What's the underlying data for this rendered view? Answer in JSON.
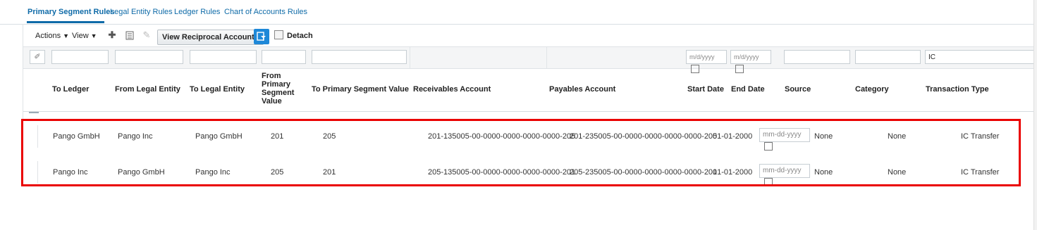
{
  "tabs": [
    {
      "label": "Primary Segment Rules",
      "active": true
    },
    {
      "label": "Legal Entity Rules",
      "active": false
    },
    {
      "label": "Ledger Rules",
      "active": false
    },
    {
      "label": "Chart of Accounts Rules",
      "active": false
    }
  ],
  "toolbar": {
    "actions_label": "Actions",
    "view_label": "View",
    "view_reciprocal_label": "View Reciprocal Accounts",
    "detach_label": "Detach",
    "icons": [
      "add-icon",
      "edit-list-icon",
      "pencil-icon",
      "filter-icon",
      "detach-icon"
    ]
  },
  "filters": {
    "start_date_placeholder": "m/d/yyyy",
    "end_date_placeholder": "m/d/yyyy",
    "transaction_type_value": "IC"
  },
  "columns": [
    "To Ledger",
    "From Legal Entity",
    "To Legal Entity",
    "From Primary Segment Value",
    "To Primary Segment Value",
    "Receivables Account",
    "Payables Account",
    "Start Date",
    "End Date",
    "Source",
    "Category",
    "Transaction Type"
  ],
  "rows": [
    {
      "to_ledger": "Pango GmbH",
      "from_legal_entity": "Pango Inc",
      "to_legal_entity": "Pango GmbH",
      "from_primary": "201",
      "to_primary": "205",
      "receivables": "201-135005-00-0000-0000-0000-0000-205",
      "payables": "201-235005-00-0000-0000-0000-0000-205",
      "start_date": "01-01-2000",
      "end_date_placeholder": "mm-dd-yyyy",
      "source": "None",
      "category": "None",
      "transaction_type": "IC Transfer"
    },
    {
      "to_ledger": "Pango Inc",
      "from_legal_entity": "Pango GmbH",
      "to_legal_entity": "Pango Inc",
      "from_primary": "205",
      "to_primary": "201",
      "receivables": "205-135005-00-0000-0000-0000-0000-201",
      "payables": "205-235005-00-0000-0000-0000-0000-201",
      "start_date": "01-01-2000",
      "end_date_placeholder": "mm-dd-yyyy",
      "source": "None",
      "category": "None",
      "transaction_type": "IC Transfer"
    }
  ],
  "colors": {
    "accent": "#0f6ba8",
    "highlight": "#ea0000",
    "filter_button": "#1e88d8"
  }
}
